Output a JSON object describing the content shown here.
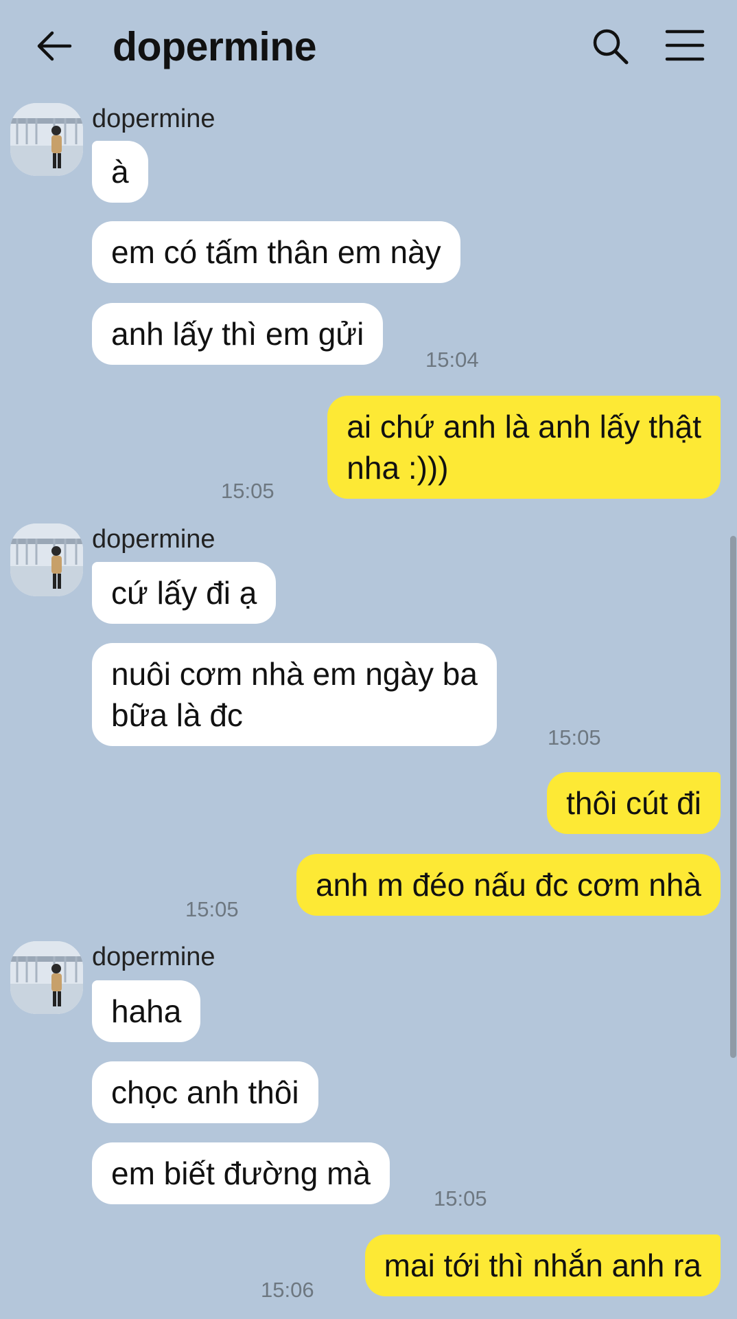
{
  "header": {
    "title": "dopermine",
    "back_icon": "arrow-left-icon",
    "search_icon": "search-icon",
    "menu_icon": "hamburger-menu-icon"
  },
  "colors": {
    "background": "#b4c6da",
    "incoming_bubble": "#ffffff",
    "outgoing_bubble": "#fde935"
  },
  "messages": {
    "g1": {
      "sender": "dopermine",
      "m1": "à",
      "m2": "em có tấm thân em này",
      "m3": "anh lấy thì em gửi",
      "time": "15:04"
    },
    "o1": {
      "m1": "ai chứ anh là anh lấy thật\nnha :)))",
      "time": "15:05"
    },
    "g2": {
      "sender": "dopermine",
      "m1": "cứ lấy đi ạ",
      "m2": "nuôi cơm nhà em ngày ba\nbữa là đc",
      "time": "15:05"
    },
    "o2": {
      "m1": "thôi cút đi",
      "m2": "anh m đéo nấu đc cơm nhà",
      "time": "15:05"
    },
    "g3": {
      "sender": "dopermine",
      "m1": "haha",
      "m2": "chọc anh thôi",
      "m3": "em biết đường mà",
      "time": "15:05"
    },
    "o3": {
      "m1": "mai tới thì nhắn anh ra",
      "time": "15:06"
    }
  }
}
